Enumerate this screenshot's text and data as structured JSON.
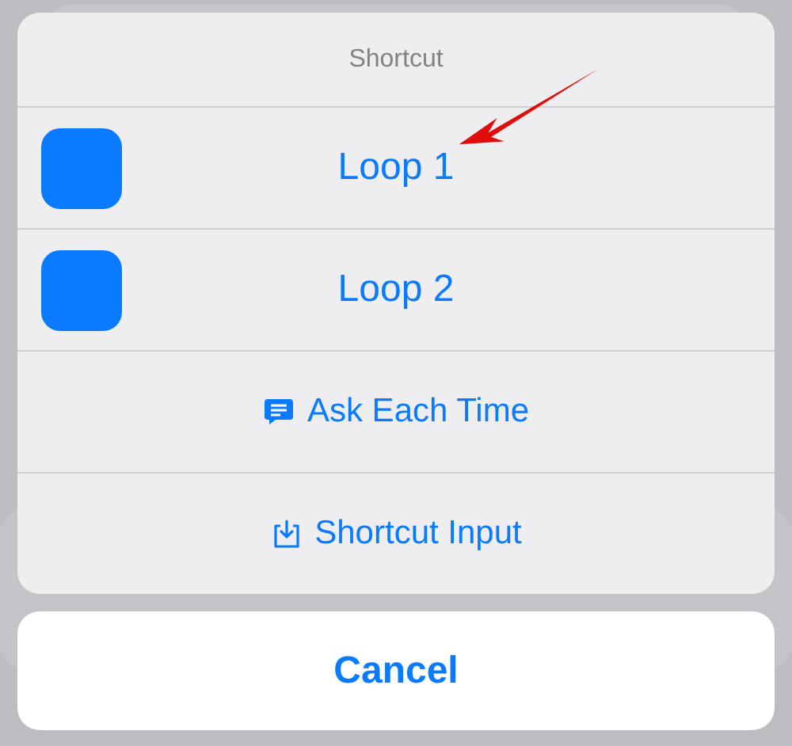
{
  "sheet": {
    "title": "Shortcut",
    "items": [
      {
        "kind": "app",
        "label": "Loop 1"
      },
      {
        "kind": "app",
        "label": "Loop 2"
      },
      {
        "kind": "ask",
        "label": "Ask Each Time"
      },
      {
        "kind": "input",
        "label": "Shortcut Input"
      }
    ]
  },
  "cancel": {
    "label": "Cancel"
  }
}
